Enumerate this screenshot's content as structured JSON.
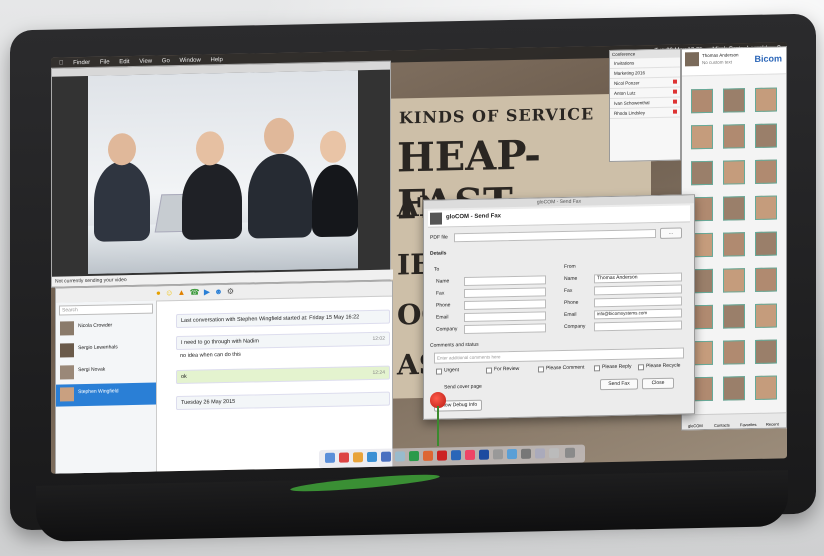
{
  "menubar": {
    "items": [
      "Finder",
      "File",
      "Edit",
      "View",
      "Go",
      "Window",
      "Help"
    ],
    "clock": "Tue 26 May 12:25",
    "user": "Mirek Gratenbergold"
  },
  "poster": {
    "line1": "KINDS OF SERVICE",
    "line2": "HEAP-FAST",
    "line3": "AN",
    "line4": "IE",
    "line5": "OO",
    "line6": "AS"
  },
  "video": {
    "status_text": "Not currently sending your video"
  },
  "chat": {
    "search_placeholder": "Search",
    "contacts": [
      {
        "name": "Nicola Crowder"
      },
      {
        "name": "Sergio Lewenhals"
      },
      {
        "name": "Sergi Novak"
      },
      {
        "name": "Stephen Wingfield"
      }
    ],
    "messages": [
      {
        "text": "Last conversation with Stephen Wingfield started at: Friday 15 May 16:22",
        "time": ""
      },
      {
        "text": "I need to go through with Nadim",
        "time": "12:02"
      },
      {
        "text": "no idea when can do this",
        "time": ""
      },
      {
        "text": "ok",
        "time": "12:24"
      },
      {
        "text": "Tuesday 26 May 2015",
        "time": ""
      }
    ]
  },
  "fax": {
    "window_title": "gloCOM - Send Fax",
    "header": "gloCOM - Send Fax",
    "pdf_label": "PDF file",
    "details_label": "Details",
    "to_label": "To",
    "from_label": "From",
    "to_fields": [
      "Name",
      "Fax",
      "Phone",
      "Email",
      "Company"
    ],
    "from_fields": [
      "Name",
      "Fax",
      "Phone",
      "Email",
      "Company"
    ],
    "from_values": [
      "Thomas Anderson",
      "",
      "",
      "info@bicomsystems.com",
      ""
    ],
    "comments_label": "Comments and status",
    "comments_placeholder": "Enter additional comments here",
    "checkboxes": [
      "Urgent",
      "For Review",
      "Please Comment",
      "Please Reply",
      "Please Recycle"
    ],
    "send_cover": "Send cover page",
    "debug_button": "Show Debug Info",
    "send_button": "Send Fax",
    "close_button": "Close"
  },
  "conference": {
    "title": "Conference",
    "items": [
      "Invitations",
      "Marketing 2016",
      "Nicol Ponzer",
      "Anton Lutz",
      "Ivan Schowenthal",
      "Rhoda Lindsley"
    ]
  },
  "contacts_panel": {
    "owner": "Thomas Anderson",
    "owner_status": "No custom text",
    "brand": "Bicom",
    "tabs": [
      "gloCOM",
      "Contacts",
      "Favorites",
      "Recent"
    ]
  },
  "colors": {
    "selection": "#2a7fd6",
    "brand": "#2b66b8",
    "busy": "#dd3333"
  }
}
